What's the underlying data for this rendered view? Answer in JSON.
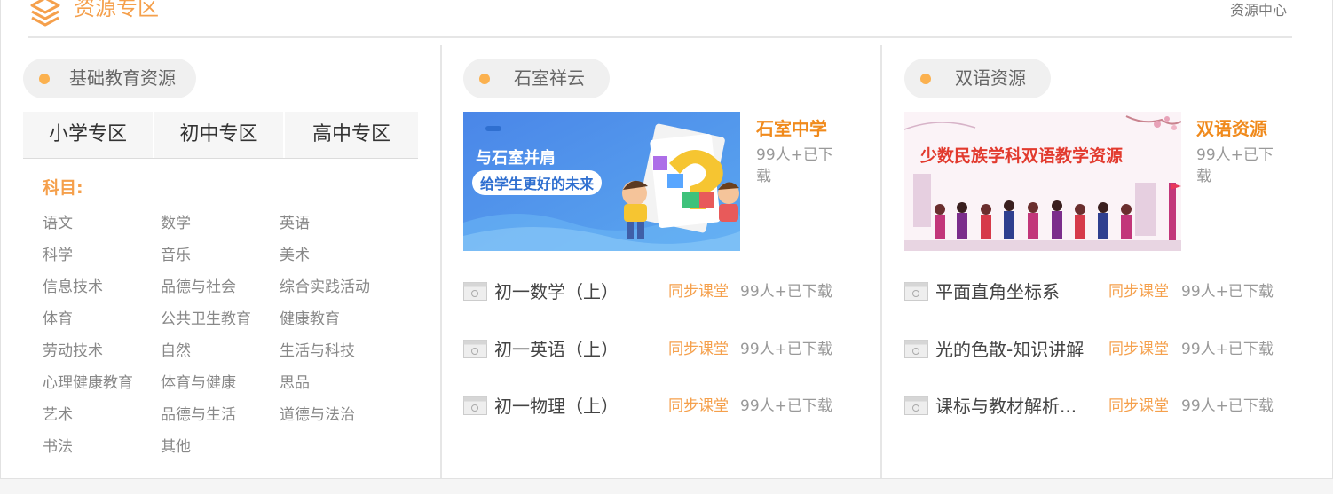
{
  "header": {
    "title": "资源专区",
    "more_link": "资源中心",
    "icon": "layers-icon"
  },
  "basic": {
    "tag": "基础教育资源",
    "tabs": [
      "小学专区",
      "初中专区",
      "高中专区"
    ],
    "subject_heading": "科目:",
    "subjects": [
      "语文",
      "数学",
      "英语",
      "科学",
      "音乐",
      "美术",
      "信息技术",
      "品德与社会",
      "综合实践活动",
      "体育",
      "公共卫生教育",
      "健康教育",
      "劳动技术",
      "自然",
      "生活与科技",
      "心理健康教育",
      "体育与健康",
      "思品",
      "艺术",
      "品德与生活",
      "道德与法治",
      "书法",
      "其他"
    ]
  },
  "shishi": {
    "tag": "石室祥云",
    "banner": {
      "line1": "与石室并肩",
      "line2": "给学生更好的未来"
    },
    "feature_title": "石室中学",
    "feature_count": "99人+已下载",
    "items": [
      {
        "title": "初一数学（上）",
        "tag": "同步课堂",
        "count": "99人+已下载"
      },
      {
        "title": "初一英语（上）",
        "tag": "同步课堂",
        "count": "99人+已下载"
      },
      {
        "title": "初一物理（上）",
        "tag": "同步课堂",
        "count": "99人+已下载"
      }
    ]
  },
  "bilingual": {
    "tag": "双语资源",
    "banner": {
      "line1": "少数民族学科双语教学资源"
    },
    "feature_title": "双语资源",
    "feature_count": "99人+已下载",
    "items": [
      {
        "title": "平面直角坐标系",
        "tag": "同步课堂",
        "count": "99人+已下载"
      },
      {
        "title": "光的色散-知识讲解",
        "tag": "同步课堂",
        "count": "99人+已下载"
      },
      {
        "title": "课标与教材解析...",
        "tag": "同步课堂",
        "count": "99人+已下载"
      }
    ]
  },
  "colors": {
    "accent": "#f5a04c",
    "title_orange": "#f08a1c",
    "dot": "#fbb14f"
  }
}
